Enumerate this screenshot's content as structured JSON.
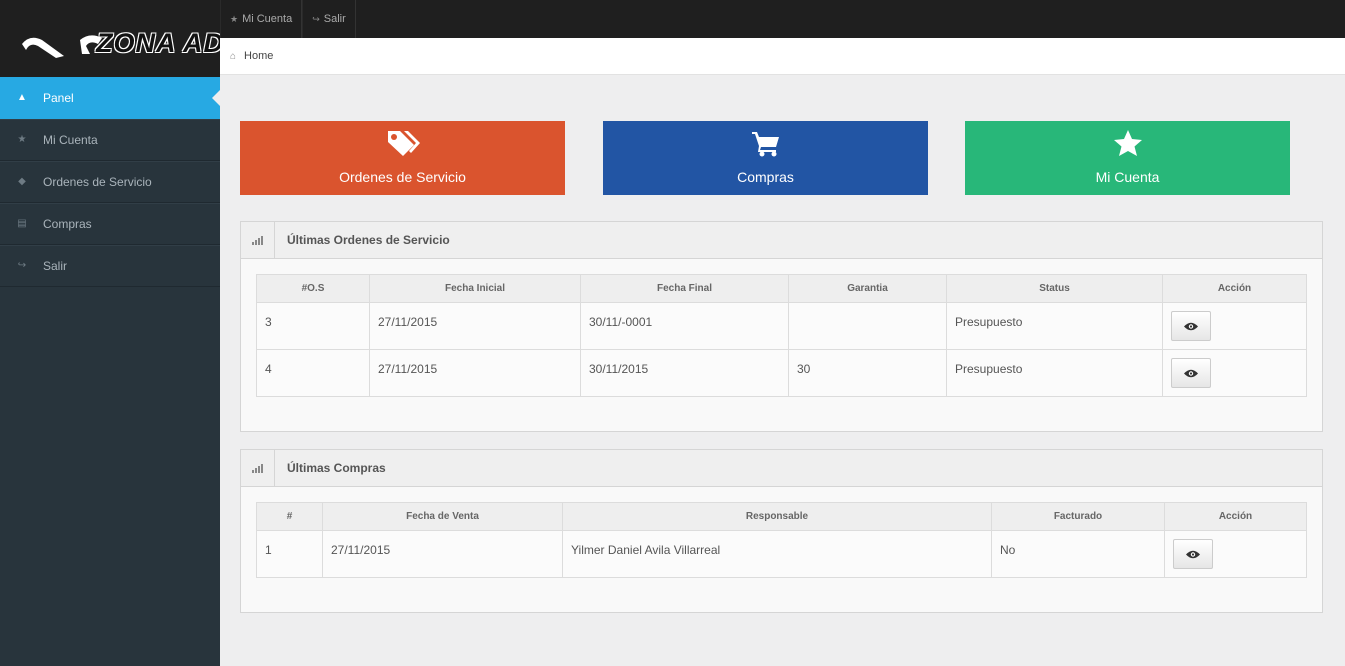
{
  "brand": {
    "name": "ZONA AD"
  },
  "topbar": {
    "items": [
      {
        "label": "Mi Cuenta",
        "icon": "user-icon"
      },
      {
        "label": "Salir",
        "icon": "share-icon"
      }
    ]
  },
  "breadcrumb": {
    "home_label": "Home"
  },
  "sidebar": {
    "items": [
      {
        "label": "Panel",
        "icon": "home-icon",
        "active": true
      },
      {
        "label": "Mi Cuenta",
        "icon": "star-icon"
      },
      {
        "label": "Ordenes de Servicio",
        "icon": "tag-icon"
      },
      {
        "label": "Compras",
        "icon": "list-icon"
      },
      {
        "label": "Salir",
        "icon": "share-icon"
      }
    ]
  },
  "tiles": [
    {
      "label": "Ordenes de Servicio",
      "icon": "tags-icon",
      "color": "#da542e"
    },
    {
      "label": "Compras",
      "icon": "cart-icon",
      "color": "#2255a4"
    },
    {
      "label": "Mi Cuenta",
      "icon": "star-icon",
      "color": "#28b779"
    }
  ],
  "orders": {
    "title": "Últimas Ordenes de Servicio",
    "headers": [
      "#O.S",
      "Fecha Inicial",
      "Fecha Final",
      "Garantia",
      "Status",
      "Acción"
    ],
    "rows": [
      [
        "3",
        "27/11/2015",
        "30/11/-0001",
        "",
        "Presupuesto"
      ],
      [
        "4",
        "27/11/2015",
        "30/11/2015",
        "30",
        "Presupuesto"
      ]
    ]
  },
  "purchases": {
    "title": "Últimas Compras",
    "headers": [
      "#",
      "Fecha de Venta",
      "Responsable",
      "Facturado",
      "Acción"
    ],
    "rows": [
      [
        "1",
        "27/11/2015",
        "Yilmer Daniel Avila Villarreal",
        "No"
      ]
    ]
  }
}
